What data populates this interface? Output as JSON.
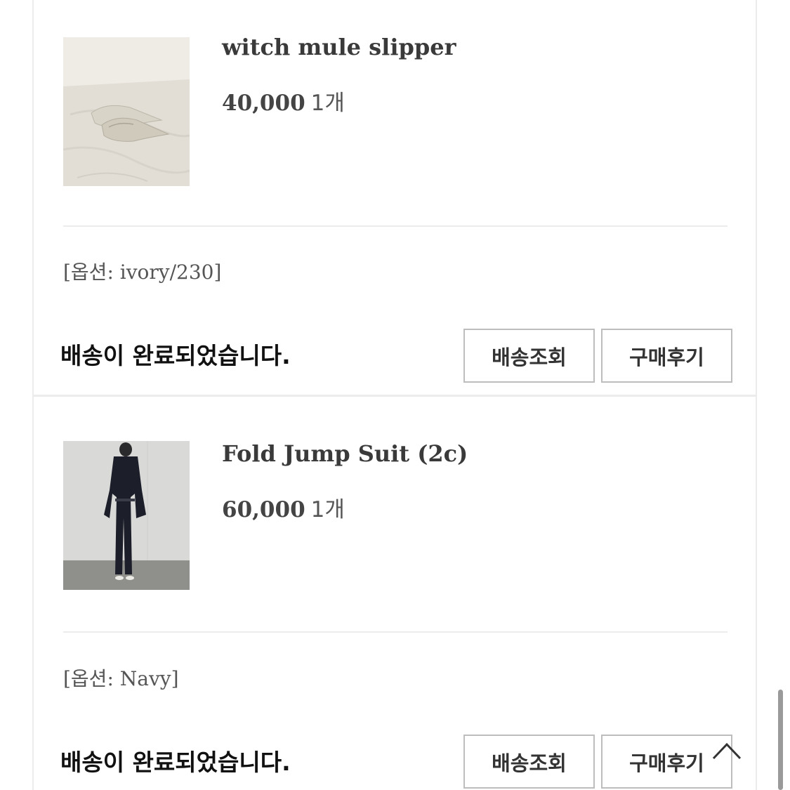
{
  "items": [
    {
      "title": "witch mule slipper",
      "price": "40,000",
      "quantity": "1개",
      "option": "[옵션: ivory/230]",
      "status": "배송이 완료되었습니다.",
      "track_label": "배송조회",
      "review_label": "구매후기"
    },
    {
      "title": "Fold Jump Suit (2c)",
      "price": "60,000",
      "quantity": "1개",
      "option": "[옵션: Navy]",
      "status": "배송이 완료되었습니다.",
      "track_label": "배송조회",
      "review_label": "구매후기"
    }
  ],
  "icons": {
    "scroll_top": "chevron-up-icon"
  },
  "colors": {
    "border": "#ececec",
    "button_border": "#bdbdbd",
    "status_text": "#111111",
    "title_text": "#3a3a3a"
  }
}
